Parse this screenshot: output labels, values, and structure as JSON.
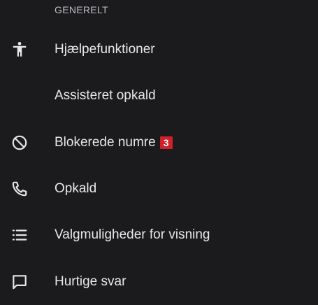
{
  "section": {
    "header": "GENERELT"
  },
  "items": [
    {
      "label": "Hjælpefunktioner",
      "icon": "accessibility-icon"
    },
    {
      "label": "Assisteret opkald",
      "icon": ""
    },
    {
      "label": "Blokerede numre",
      "icon": "block-icon",
      "badge": "3"
    },
    {
      "label": "Opkald",
      "icon": "phone-icon"
    },
    {
      "label": "Valgmuligheder for visning",
      "icon": "list-icon"
    },
    {
      "label": "Hurtige svar",
      "icon": "message-icon"
    }
  ],
  "colors": {
    "background": "#1b1b1e",
    "text": "#e8e8eb",
    "header_text": "#b9bcc2",
    "badge": "#d0202a"
  }
}
